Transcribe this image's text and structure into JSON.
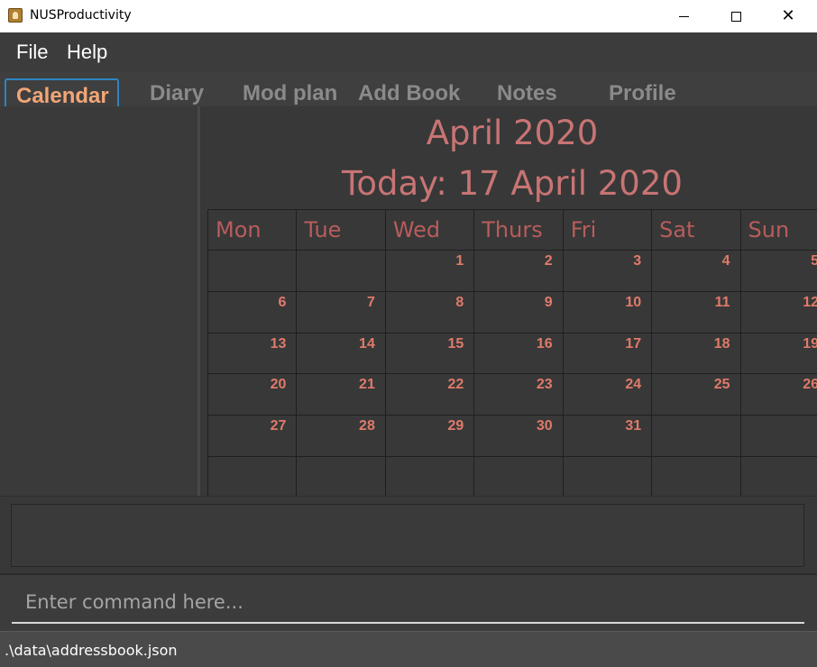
{
  "window": {
    "title": "NUSProductivity",
    "icon": "app-icon",
    "controls": {
      "minimize": "minimize-icon",
      "maximize": "maximize-icon",
      "close": "✕"
    }
  },
  "menu": {
    "file": "File",
    "help": "Help"
  },
  "tabs": [
    {
      "label": "Calendar",
      "active": true
    },
    {
      "label": "Diary"
    },
    {
      "label": "Mod plan"
    },
    {
      "label": "Add Book"
    },
    {
      "label": "Notes"
    },
    {
      "label": "Profile"
    }
  ],
  "calendar": {
    "month_title": "April 2020",
    "today_label": "Today: 17 April 2020",
    "weekdays": [
      "Mon",
      "Tue",
      "Wed",
      "Thurs",
      "Fri",
      "Sat",
      "Sun"
    ],
    "weeks": [
      [
        "",
        "",
        "1",
        "2",
        "3",
        "4",
        "5"
      ],
      [
        "6",
        "7",
        "8",
        "9",
        "10",
        "11",
        "12"
      ],
      [
        "13",
        "14",
        "15",
        "16",
        "17",
        "18",
        "19"
      ],
      [
        "20",
        "21",
        "22",
        "23",
        "24",
        "25",
        "26"
      ],
      [
        "27",
        "28",
        "29",
        "30",
        "31",
        "",
        ""
      ],
      [
        "",
        "",
        "",
        "",
        "",
        "",
        ""
      ]
    ]
  },
  "result": {
    "text": ""
  },
  "command": {
    "placeholder": "Enter command here...",
    "value": ""
  },
  "status": {
    "path": ".\\data\\addressbook.json"
  },
  "colors": {
    "background": "#3c3c3c",
    "accent_tab": "#f2a676",
    "tab_focus_border": "#2f84c2",
    "calendar_title": "#c87474",
    "day_number": "#e07a6a"
  }
}
